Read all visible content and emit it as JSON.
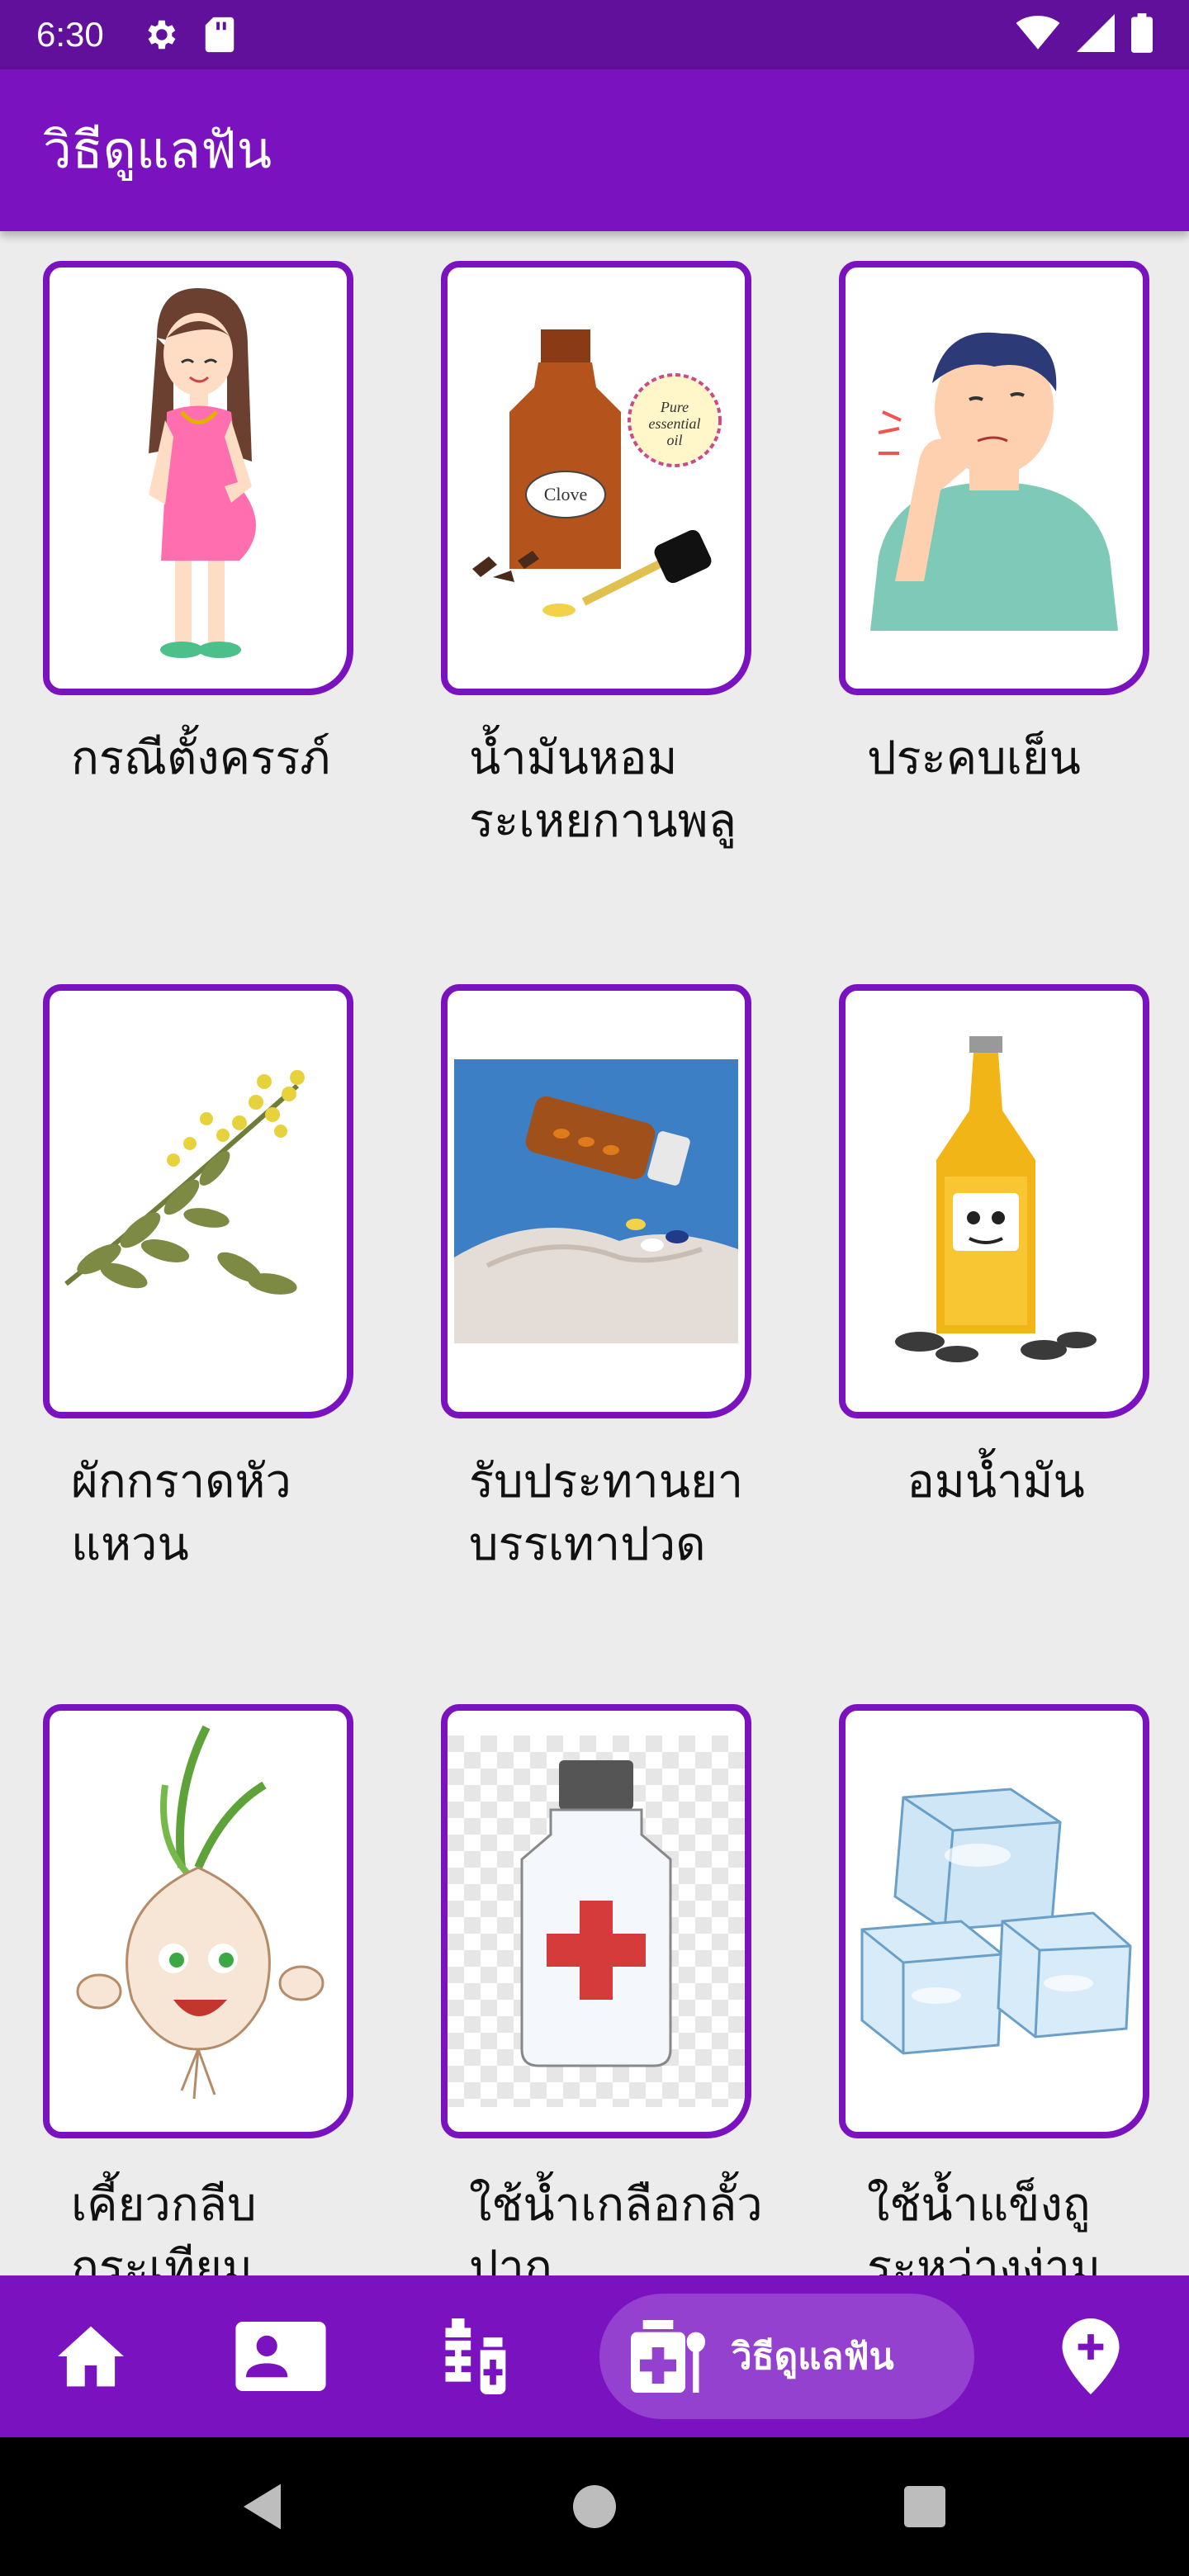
{
  "status_bar": {
    "time": "6:30",
    "icons": [
      "gear-icon",
      "sd-card-icon",
      "wifi-icon",
      "signal-icon",
      "battery-icon"
    ]
  },
  "app_bar": {
    "title": "วิธีดูแลฟัน"
  },
  "items": [
    {
      "label": "กรณีตั้งครรภ์",
      "image": "pregnant-woman"
    },
    {
      "label": "น้ำมันหอมระเหยกานพลู",
      "image": "clove-essential-oil"
    },
    {
      "label": "ประคบเย็น",
      "image": "man-with-toothache"
    },
    {
      "label": "ผักกราดหัวแหวน",
      "image": "herb-plant"
    },
    {
      "label": "รับประทานยาบรรเทาปวด",
      "image": "pills-in-hand"
    },
    {
      "label": "อมน้ำมัน",
      "image": "sunflower-oil-bottle"
    },
    {
      "label": "เคี้ยวกลีบกระเทียม",
      "image": "garlic-character"
    },
    {
      "label": "ใช้น้ำเกลือกลั้วปาก",
      "image": "saline-bottle"
    },
    {
      "label": "ใช้น้ำแข็งถูระหว่างง่าม",
      "image": "ice-cubes"
    }
  ],
  "bottom_nav": {
    "items": [
      "home-icon",
      "contact-card-icon",
      "medicine-icon",
      "dental-care-icon",
      "location-pin-icon"
    ],
    "active_label": "วิธีดูแลฟัน"
  },
  "colors": {
    "primary": "#7a12c0",
    "status_bar": "#60109a",
    "active_pill": "#9541cf",
    "background": "#ececec"
  }
}
